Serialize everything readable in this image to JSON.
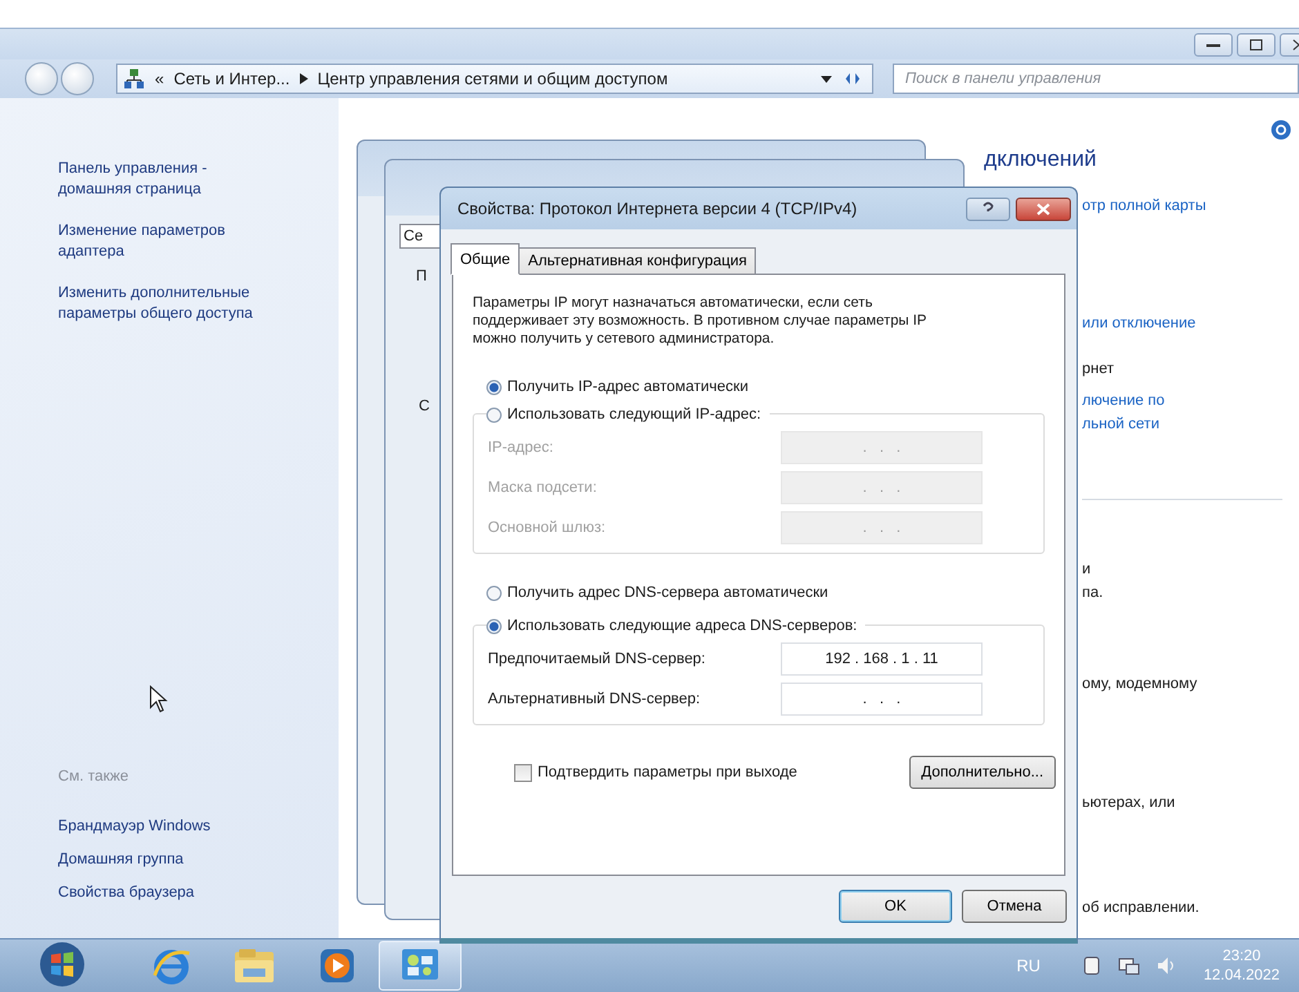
{
  "address_bar": {
    "overflow_marker": "«",
    "crumbs": [
      "Сеть и Интер...",
      "Центр управления сетями и общим доступом"
    ]
  },
  "search": {
    "placeholder": "Поиск в панели управления"
  },
  "sidebar": {
    "items": [
      "Панель управления - домашняя страница",
      "Изменение параметров адаптера",
      "Изменить дополнительные параметры общего доступа"
    ],
    "see_also_heading": "См. также",
    "see_also": [
      "Брандмауэр Windows",
      "Домашняя группа",
      "Свойства браузера"
    ]
  },
  "content": [
    {
      "kind": "heading",
      "text": "дключений"
    },
    {
      "kind": "link",
      "text": "отр полной карты"
    },
    {
      "kind": "link",
      "text": "или отключение"
    },
    {
      "kind": "text",
      "text": "рнет"
    },
    {
      "kind": "link",
      "text": "лючение по\nльной сети"
    },
    {
      "kind": "divider"
    },
    {
      "kind": "text",
      "text": "и\nпа."
    },
    {
      "kind": "text",
      "text": "ому, модемному"
    },
    {
      "kind": "text",
      "text": "ьютерах, или"
    },
    {
      "kind": "text",
      "text": "об исправлении."
    }
  ],
  "back_dialog": {
    "tab": "Се",
    "labels": [
      "П",
      "С"
    ]
  },
  "dialog": {
    "title": "Свойства: Протокол Интернета версии 4 (TCP/IPv4)",
    "tabs": [
      {
        "label": "Общие",
        "selected": true
      },
      {
        "label": "Альтернативная конфигурация",
        "selected": false
      }
    ],
    "description": "Параметры IP могут назначаться автоматически, если сеть поддерживает эту возможность. В противном случае параметры IP можно получить у сетевого администратора.",
    "ip_mode": [
      {
        "label": "Получить IP-адрес автоматически",
        "selected": true
      },
      {
        "label": "Использовать следующий IP-адрес:",
        "selected": false
      }
    ],
    "ip_fields": [
      {
        "label": "IP-адрес:",
        "value": ".   .   .",
        "disabled": true
      },
      {
        "label": "Маска подсети:",
        "value": ".   .   .",
        "disabled": true
      },
      {
        "label": "Основной шлюз:",
        "value": ".   .   .",
        "disabled": true
      }
    ],
    "dns_mode": [
      {
        "label": "Получить адрес DNS-сервера автоматически",
        "selected": false
      },
      {
        "label": "Использовать следующие адреса DNS-серверов:",
        "selected": true
      }
    ],
    "dns_fields": [
      {
        "label": "Предпочитаемый DNS-сервер:",
        "value": "192 . 168 . 1 . 11",
        "disabled": false
      },
      {
        "label": "Альтернативный DNS-сервер:",
        "value": ".   .   .",
        "disabled": false
      }
    ],
    "validate": {
      "label": "Подтвердить параметры при выходе",
      "checked": false
    },
    "advanced_button": "Дополнительно...",
    "buttons": [
      {
        "label": "OK",
        "default": true
      },
      {
        "label": "Отмена",
        "default": false
      }
    ]
  },
  "taskbar": {
    "apps": [
      {
        "kind": "browser",
        "selected": false
      },
      {
        "kind": "folder",
        "selected": false
      },
      {
        "kind": "media",
        "selected": false
      },
      {
        "kind": "network",
        "selected": true
      }
    ],
    "language": "RU",
    "time": "23:20",
    "date": "12.04.2022"
  }
}
